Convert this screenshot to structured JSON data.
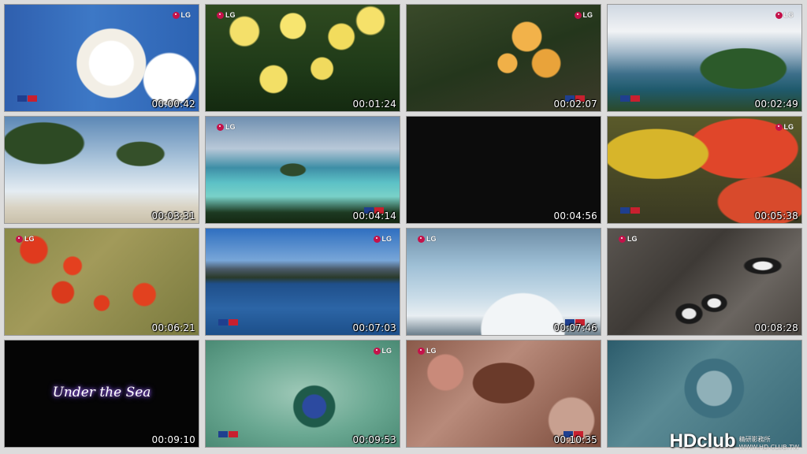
{
  "thumbnails": [
    {
      "timecode": "00:00:42",
      "logo": "LG"
    },
    {
      "timecode": "00:01:24",
      "logo": "LG"
    },
    {
      "timecode": "00:02:07",
      "logo": "LG"
    },
    {
      "timecode": "00:02:49",
      "logo": "LG"
    },
    {
      "timecode": "00:03:31",
      "logo": ""
    },
    {
      "timecode": "00:04:14",
      "logo": "LG"
    },
    {
      "timecode": "00:04:56",
      "logo": ""
    },
    {
      "timecode": "00:05:38",
      "logo": "LG"
    },
    {
      "timecode": "00:06:21",
      "logo": "LG"
    },
    {
      "timecode": "00:07:03",
      "logo": "LG"
    },
    {
      "timecode": "00:07:46",
      "logo": "LG"
    },
    {
      "timecode": "00:08:28",
      "logo": "LG"
    },
    {
      "timecode": "00:09:10",
      "logo": "",
      "title": "Under the Sea"
    },
    {
      "timecode": "00:09:53",
      "logo": "LG"
    },
    {
      "timecode": "00:10:35",
      "logo": "LG"
    },
    {
      "timecode": "",
      "logo": ""
    }
  ],
  "watermark": {
    "main": "HDclub",
    "side_top": "精研影務所",
    "side_bottom": "WWW.HD.CLUB.TW"
  },
  "colors": {
    "sheet_background": "#dcdcdc",
    "lg_red": "#c4124a",
    "timecode_text": "#ffffff"
  }
}
